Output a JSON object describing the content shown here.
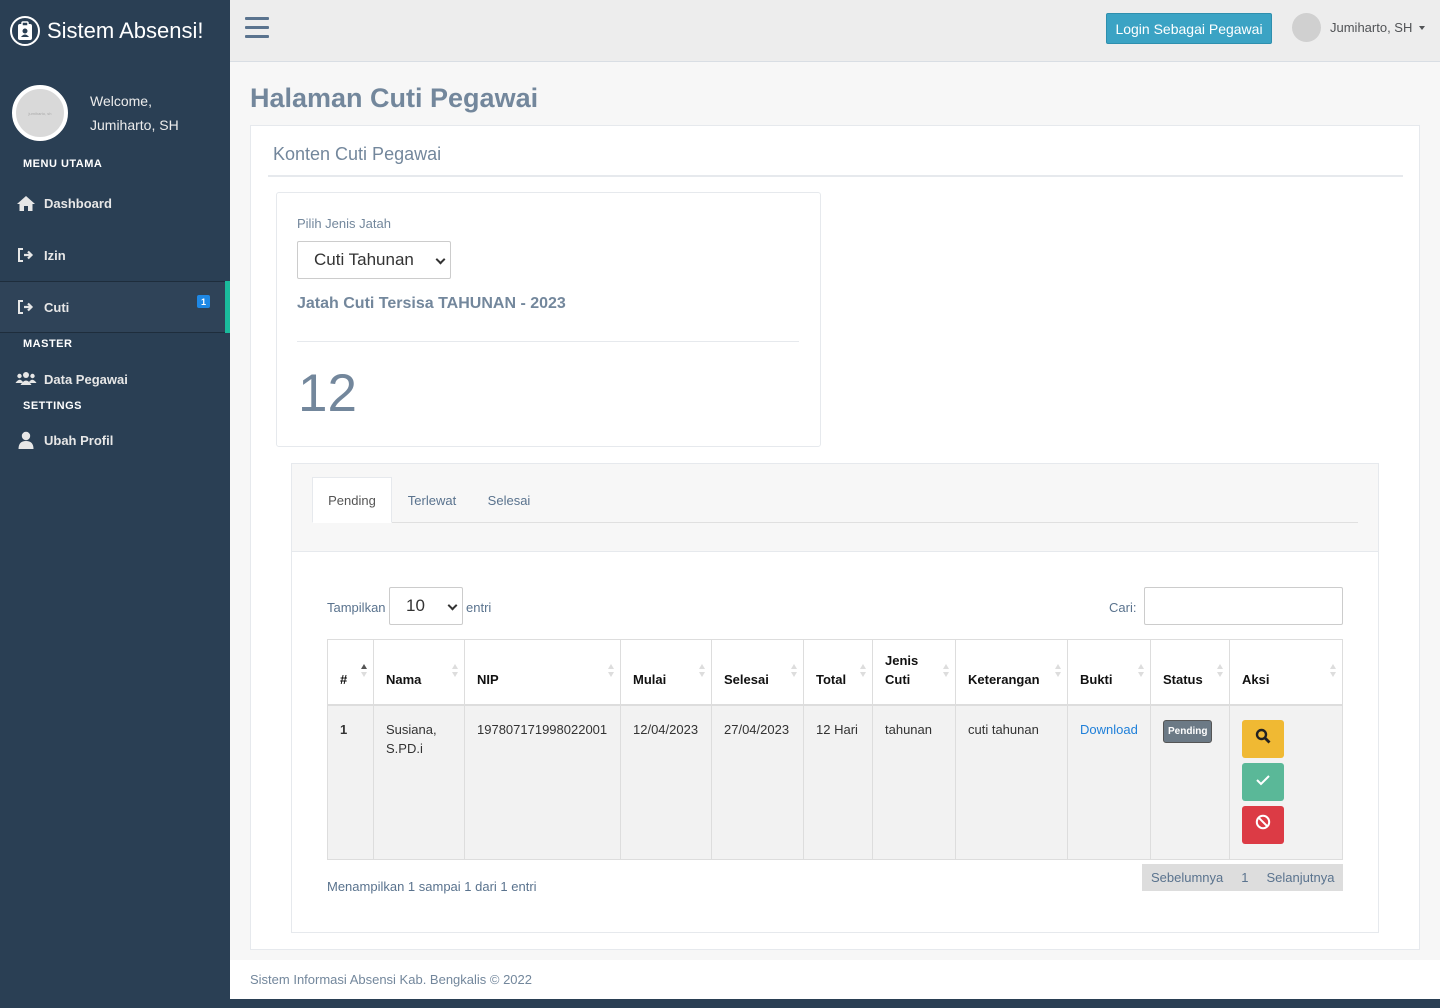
{
  "brand": {
    "title": "Sistem Absensi!"
  },
  "profile": {
    "welcome": "Welcome,",
    "name": "Jumiharto, SH",
    "avatar_caption": "jumiharto, sh"
  },
  "sidebar": {
    "sections": [
      "MENU UTAMA",
      "MASTER",
      "SETTINGS"
    ],
    "items": [
      {
        "label": "Dashboard",
        "icon": "home-icon"
      },
      {
        "label": "Izin",
        "icon": "sign-out-icon"
      },
      {
        "label": "Cuti",
        "icon": "sign-out-icon",
        "badge": "1",
        "active": true
      },
      {
        "label": "Data Pegawai",
        "icon": "users-icon"
      },
      {
        "label": "Ubah Profil",
        "icon": "user-icon"
      }
    ]
  },
  "topnav": {
    "login_button": "Login Sebagai Pegawai",
    "user_name": "Jumiharto, SH"
  },
  "page": {
    "title": "Halaman Cuti Pegawai",
    "panel_title": "Konten Cuti Pegawai"
  },
  "quota": {
    "label": "Pilih Jenis Jatah",
    "selected": "Cuti Tahunan",
    "heading": "Jatah Cuti Tersisa TAHUNAN - 2023",
    "remaining": "12"
  },
  "tabs": [
    {
      "label": "Pending",
      "active": true
    },
    {
      "label": "Terlewat"
    },
    {
      "label": "Selesai"
    }
  ],
  "datatable": {
    "length_label": "Tampilkan",
    "length_value": "10",
    "length_after": "entri",
    "search_label": "Cari:",
    "search_value": "",
    "columns": [
      "#",
      "Nama",
      "NIP",
      "Mulai",
      "Selesai",
      "Total",
      "Jenis Cuti",
      "Keterangan",
      "Bukti",
      "Status",
      "Aksi"
    ],
    "rows": [
      {
        "no": "1",
        "nama": "Susiana, S.PD.i",
        "nip": "197807171998022001",
        "mulai": "12/04/2023",
        "selesai": "27/04/2023",
        "total": "12 Hari",
        "jenis": "tahunan",
        "keterangan": "cuti tahunan",
        "bukti": "Download",
        "status": "Pending"
      }
    ],
    "info": "Menampilkan 1 sampai 1 dari 1 entri",
    "pager": {
      "prev": "Sebelumnya",
      "page": "1",
      "next": "Selanjutnya"
    }
  },
  "footer": {
    "text": "Sistem Informasi Absensi Kab. Bengkalis © 2022"
  },
  "colors": {
    "sidebar_bg": "#2a3f54",
    "accent": "#1abb9c",
    "login_btn": "#3ba3c4",
    "view_btn": "#f0b933",
    "approve_btn": "#5ab898",
    "reject_btn": "#dc3b45"
  }
}
